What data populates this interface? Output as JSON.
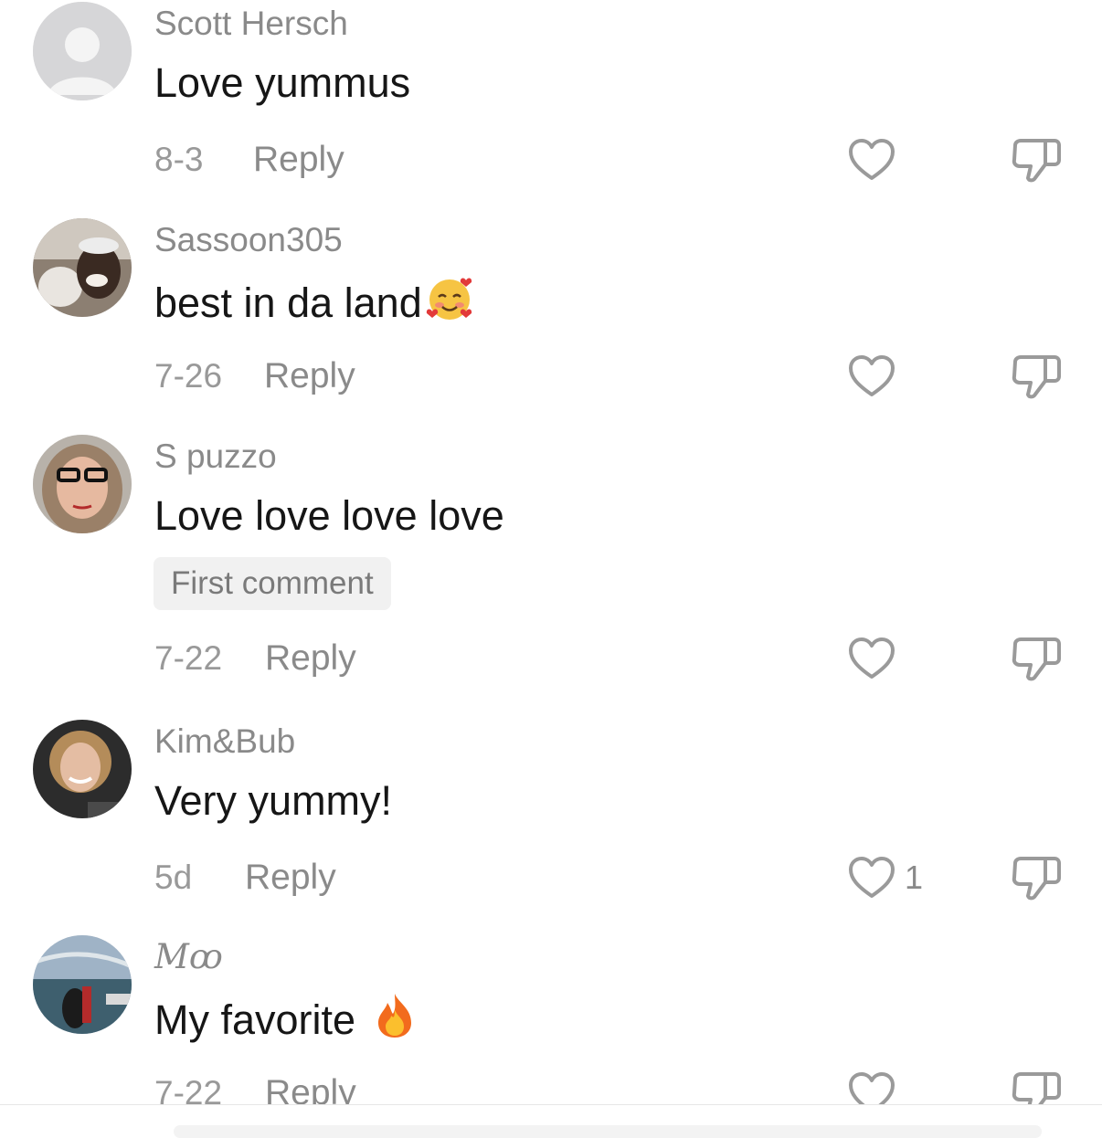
{
  "comments": [
    {
      "username": "Scott Hersch",
      "text": "Love yummus",
      "date": "8-3",
      "reply_label": "Reply",
      "avatar": "default-avatar",
      "like_count": ""
    },
    {
      "username": "Sassoon305",
      "text": "best in da land",
      "emoji": "smiling-face-with-hearts",
      "date": "7-26",
      "reply_label": "Reply",
      "avatar": "photo-avatar",
      "like_count": ""
    },
    {
      "username": "S puzzo",
      "text": "Love love love love",
      "badge": "First comment",
      "date": "7-22",
      "reply_label": "Reply",
      "avatar": "photo-avatar",
      "like_count": ""
    },
    {
      "username": "Kim&Bub",
      "text": "Very yummy!",
      "date": "5d",
      "reply_label": "Reply",
      "avatar": "photo-avatar",
      "like_count": "1"
    },
    {
      "username": "Mꝏ",
      "text": "My favorite ",
      "emoji": "fire",
      "date": "7-22",
      "reply_label": "Reply",
      "avatar": "photo-avatar",
      "like_count": ""
    }
  ],
  "icons": {
    "like": "heart-outline-icon",
    "dislike": "thumbs-down-outline-icon"
  },
  "colors": {
    "username": "#8a8a8a",
    "text": "#161616",
    "meta": "#999999",
    "badge_bg": "#f1f1f1"
  }
}
